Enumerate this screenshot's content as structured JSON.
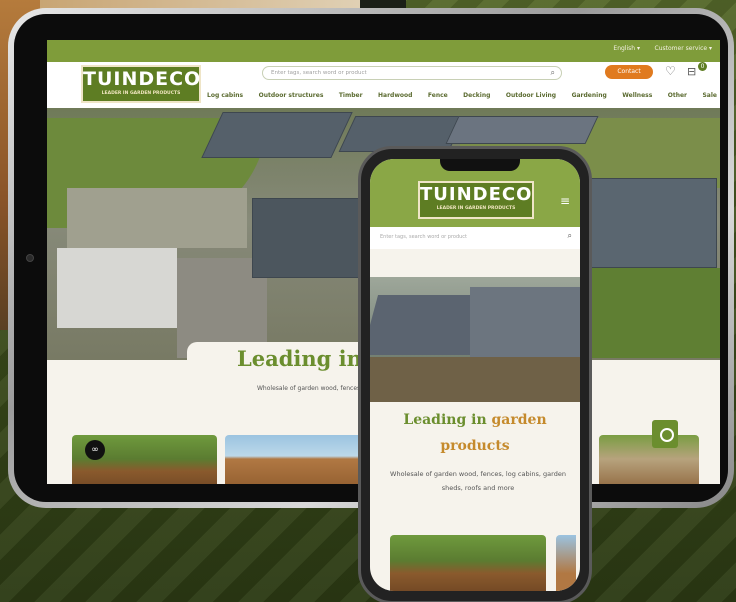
{
  "brand": {
    "logo_title": "TUINDECO",
    "logo_subtitle": "LEADER IN GARDEN PRODUCTS"
  },
  "tablet": {
    "topbar": {
      "language": "English ▾",
      "account": "Customer service ▾"
    },
    "search": {
      "placeholder": "Enter tags, search word or product"
    },
    "contact_label": "Contact",
    "cart_count": "0",
    "menu": [
      "Log cabins",
      "Outdoor structures",
      "Timber",
      "Hardwood",
      "Fence",
      "Decking",
      "Outdoor Living",
      "Gardening",
      "Wellness",
      "Other",
      "Sale"
    ],
    "hero": {
      "headline_main": "Leading in ",
      "headline_accent": "g",
      "subtitle": "Wholesale of garden wood, fences"
    }
  },
  "phone": {
    "search": {
      "placeholder": "Enter tags, search word or product"
    },
    "hero": {
      "headline_main": "Leading in ",
      "headline_accent": "garden",
      "headline_line2": "products",
      "subtitle": "Wholesale of garden wood, fences, log cabins, garden sheds, roofs and more"
    }
  },
  "colors": {
    "brand_green": "#5e7d23",
    "accent_orange": "#e07a1f",
    "headline_green": "#6b8e2e",
    "headline_gold": "#c58a2c"
  },
  "icons": {
    "search": "search-icon",
    "heart": "heart-icon",
    "cart": "cart-icon",
    "menu": "hamburger-icon",
    "chat": "chat-icon"
  }
}
